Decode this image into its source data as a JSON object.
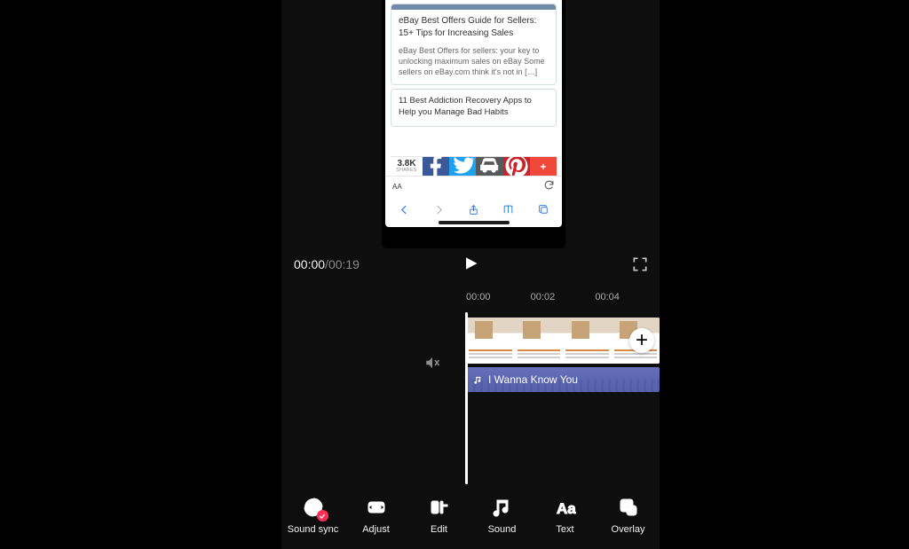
{
  "playback": {
    "current": "00:00",
    "total": "00:19"
  },
  "timeline": {
    "ticks": [
      "00:00",
      "00:02",
      "00:04"
    ],
    "audio_title": "I Wanna Know You"
  },
  "preview": {
    "post1": {
      "title": "eBay Best Offers Guide for Sellers: 15+ Tips for Increasing Sales",
      "body": "eBay Best Offers for sellers: your key to unlocking maximum sales on eBay Some sellers on eBay.com think it's not in […]"
    },
    "post2": {
      "title": "11 Best Addiction Recovery Apps to Help you Manage Bad Habits"
    },
    "shares": {
      "count": "3.8K",
      "label": "SHARES"
    },
    "addr": {
      "aA": "AA"
    }
  },
  "tools": [
    {
      "id": "sound-sync",
      "label": "Sound sync"
    },
    {
      "id": "adjust",
      "label": "Adjust"
    },
    {
      "id": "edit",
      "label": "Edit"
    },
    {
      "id": "sound",
      "label": "Sound"
    },
    {
      "id": "text",
      "label": "Text"
    },
    {
      "id": "overlay",
      "label": "Overlay"
    }
  ]
}
